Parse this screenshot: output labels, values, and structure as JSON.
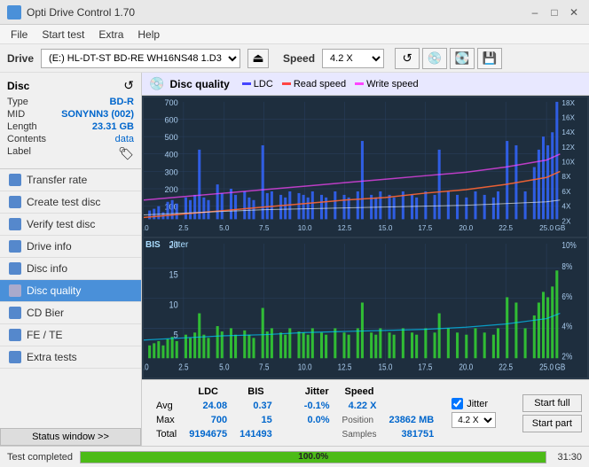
{
  "titleBar": {
    "icon": "disc",
    "title": "Opti Drive Control 1.70",
    "minimize": "–",
    "maximize": "□",
    "close": "✕"
  },
  "menuBar": {
    "items": [
      "File",
      "Start test",
      "Extra",
      "Help"
    ]
  },
  "driveBar": {
    "label": "Drive",
    "driveValue": "(E:) HL-DT-ST BD-RE  WH16NS48 1.D3",
    "speedLabel": "Speed",
    "speedValue": "4.2 X"
  },
  "disc": {
    "title": "Disc",
    "type_label": "Type",
    "type_val": "BD-R",
    "mid_label": "MID",
    "mid_val": "SONYNN3 (002)",
    "length_label": "Length",
    "length_val": "23.31 GB",
    "contents_label": "Contents",
    "contents_val": "data",
    "label_label": "Label"
  },
  "nav": {
    "items": [
      {
        "id": "transfer-rate",
        "label": "Transfer rate"
      },
      {
        "id": "create-test-disc",
        "label": "Create test disc"
      },
      {
        "id": "verify-test-disc",
        "label": "Verify test disc"
      },
      {
        "id": "drive-info",
        "label": "Drive info"
      },
      {
        "id": "disc-info",
        "label": "Disc info"
      },
      {
        "id": "disc-quality",
        "label": "Disc quality",
        "active": true
      },
      {
        "id": "cd-bier",
        "label": "CD Bier"
      },
      {
        "id": "fe-te",
        "label": "FE / TE"
      },
      {
        "id": "extra-tests",
        "label": "Extra tests"
      }
    ]
  },
  "statusBtn": "Status window >>",
  "discQuality": {
    "title": "Disc quality",
    "legend": [
      {
        "color": "#4444ff",
        "label": "LDC"
      },
      {
        "color": "#ff4444",
        "label": "Read speed"
      },
      {
        "color": "#ff44ff",
        "label": "Write speed"
      }
    ],
    "chart1": {
      "yMax": 700,
      "yLabels": [
        700,
        600,
        500,
        400,
        300,
        200,
        100
      ],
      "xMax": 25,
      "xLabels": [
        0,
        2.5,
        5.0,
        7.5,
        10.0,
        12.5,
        15.0,
        17.5,
        20.0,
        22.5,
        25.0
      ],
      "rightLabels": [
        "18X",
        "16X",
        "14X",
        "12X",
        "10X",
        "8X",
        "6X",
        "4X",
        "2X"
      ]
    },
    "chart2": {
      "title1": "BIS",
      "title2": "Jitter",
      "yMax": 20,
      "yLabels": [
        20,
        15,
        10,
        5
      ],
      "xMax": 25,
      "xLabels": [
        0,
        2.5,
        5.0,
        7.5,
        10.0,
        12.5,
        15.0,
        17.5,
        20.0,
        22.5,
        25.0
      ],
      "rightLabels": [
        "10%",
        "8%",
        "6%",
        "4%",
        "2%"
      ]
    }
  },
  "stats": {
    "headers": [
      "",
      "LDC",
      "BIS",
      "",
      "Jitter",
      "Speed",
      "",
      ""
    ],
    "avg_label": "Avg",
    "avg_ldc": "24.08",
    "avg_bis": "0.37",
    "avg_jitter": "-0.1%",
    "avg_speed_val": "4.22 X",
    "avg_speed_sel": "4.2 X",
    "max_label": "Max",
    "max_ldc": "700",
    "max_bis": "15",
    "max_jitter": "0.0%",
    "max_position_label": "Position",
    "max_position_val": "23862 MB",
    "total_label": "Total",
    "total_ldc": "9194675",
    "total_bis": "141493",
    "total_samples_label": "Samples",
    "total_samples_val": "381751",
    "jitter_checked": true,
    "btn_start_full": "Start full",
    "btn_start_part": "Start part"
  },
  "bottomBar": {
    "status": "Test completed",
    "progress": 100,
    "progress_label": "100.0%",
    "time": "31:30"
  }
}
